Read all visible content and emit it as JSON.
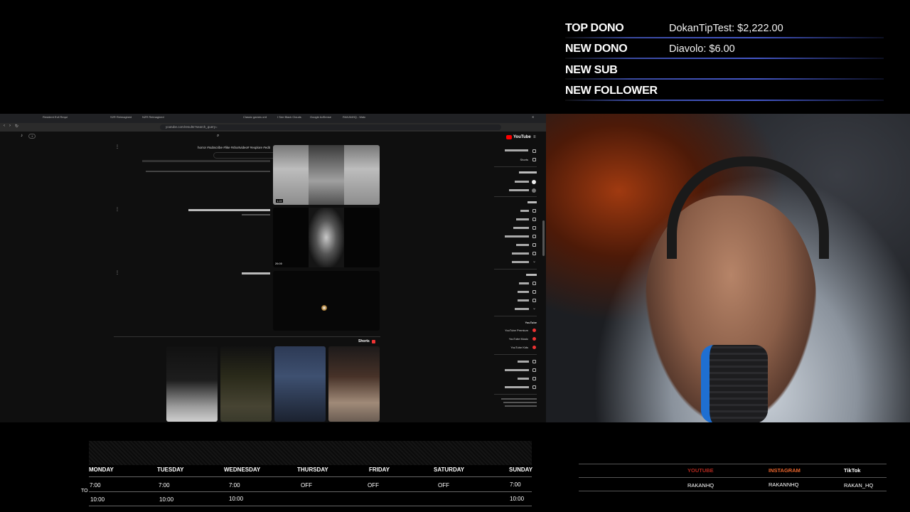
{
  "alerts": {
    "top_dono": {
      "label": "TOP DONO",
      "value": "DokanTipTest: $2,222.00"
    },
    "new_dono": {
      "label": "NEW DONO",
      "value": "Diavolo: $6.00"
    },
    "new_sub": {
      "label": "NEW SUB",
      "value": ""
    },
    "new_follower": {
      "label": "NEW FOLLOWER",
      "value": ""
    }
  },
  "browser": {
    "tabs": [
      "Resident Evil Requi",
      "S2R Reimagined",
      "NZR Reimagined",
      "Classic games onli",
      "I See Black Clouds",
      "Google AdSense",
      "RAKANHQ - Watc"
    ],
    "url": "youtube.com/results?search_query=",
    "youtube": {
      "logo": "YouTube",
      "results": [
        {
          "title": "horror #subscribe #like #shortvideo# #explore #edit",
          "duration": "1:22"
        },
        {
          "title": "",
          "duration": "26:00"
        },
        {
          "title": "",
          "duration": ""
        }
      ],
      "shorts_label": "Shorts",
      "sidebar": {
        "items": [
          "Shorts"
        ],
        "you_section": "YouTube",
        "premium": [
          "YouTube Premium",
          "YouTube Music",
          "YouTube Kids"
        ]
      }
    }
  },
  "schedule": {
    "to_label": "TO",
    "days": [
      {
        "name": "MONDAY",
        "start": "7:00",
        "end": "10:00"
      },
      {
        "name": "TUESDAY",
        "start": "7:00",
        "end": "10:00"
      },
      {
        "name": "WEDNESDAY",
        "start": "7:00",
        "end": "10:00"
      },
      {
        "name": "THURSDAY",
        "start": "OFF",
        "end": ""
      },
      {
        "name": "FRIDAY",
        "start": "OFF",
        "end": ""
      },
      {
        "name": "SATURDAY",
        "start": "OFF",
        "end": ""
      },
      {
        "name": "SUNDAY",
        "start": "7:00",
        "end": "10:00"
      }
    ]
  },
  "socials": {
    "youtube": {
      "label": "YOUTUBE",
      "handle": "RAKANHQ",
      "color": "#c0392b"
    },
    "instagram": {
      "label": "INSTAGRAM",
      "handle": "RAKANNHQ",
      "color": "#e8642c"
    },
    "tiktok": {
      "label": "TikTok",
      "handle": "RAKAN_HQ",
      "color": "#ffffff"
    }
  }
}
